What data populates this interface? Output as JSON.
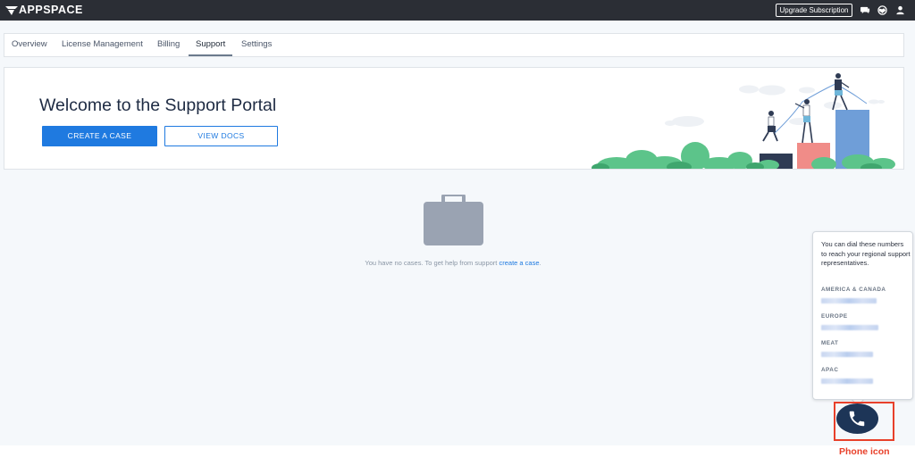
{
  "app": {
    "brand": "APPSPACE"
  },
  "topbar": {
    "upgrade_label": "Upgrade Subscription"
  },
  "tabs": [
    {
      "label": "Overview"
    },
    {
      "label": "License Management"
    },
    {
      "label": "Billing"
    },
    {
      "label": "Support",
      "active": true
    },
    {
      "label": "Settings"
    }
  ],
  "welcome": {
    "title": "Welcome to the Support Portal",
    "create_label": "CREATE A CASE",
    "docs_label": "VIEW DOCS"
  },
  "empty_state": {
    "message": "You have no cases. To get help from support ",
    "link": "create a case",
    "suffix": "."
  },
  "popover": {
    "intro": "You can dial these numbers to reach your regional support representatives.",
    "regions": [
      {
        "name": "AMERICA & CANADA"
      },
      {
        "name": "EUROPE"
      },
      {
        "name": "MEAT"
      },
      {
        "name": "APAC"
      }
    ]
  },
  "annotation": {
    "label": "Phone icon"
  },
  "icons": {
    "topbar": [
      "chat-icon",
      "globe-icon",
      "user-icon"
    ],
    "empty": "briefcase-icon",
    "phone": "phone-icon"
  },
  "colors": {
    "topbar": "#2b2e35",
    "primary": "#1f7ae0",
    "title": "#1e2b43",
    "phone_button": "#1d3557",
    "annotation": "#e8402a"
  }
}
